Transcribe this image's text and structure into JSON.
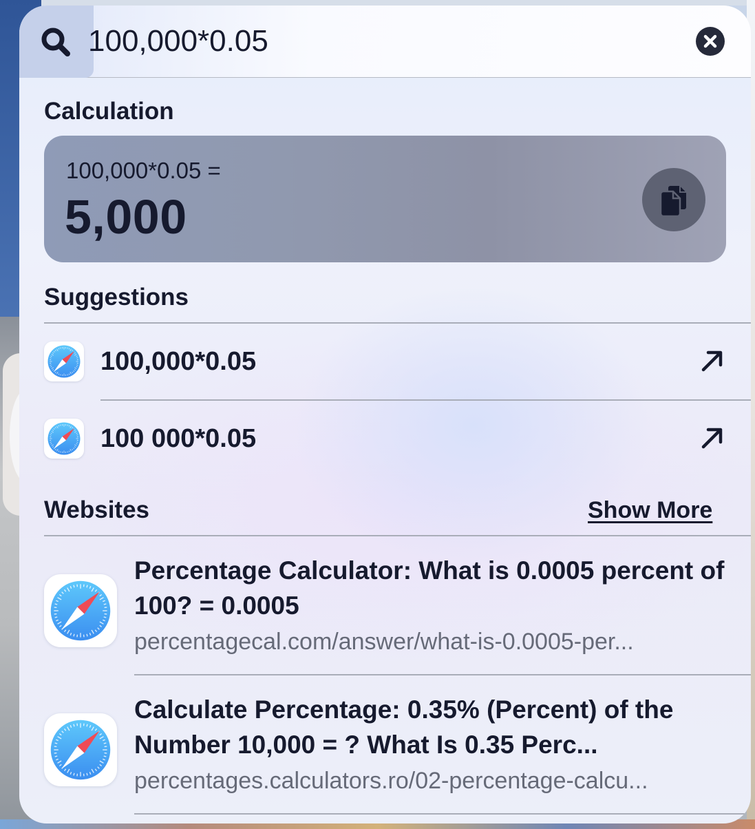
{
  "search": {
    "query": "100,000*0.05",
    "icon": "magnifying-glass",
    "clear_icon": "xmark-circle-fill"
  },
  "calculation": {
    "section_title": "Calculation",
    "expression": "100,000*0.05 =",
    "result": "5,000",
    "copy_icon": "doc-on-doc-fill"
  },
  "suggestions": {
    "section_title": "Suggestions",
    "items": [
      {
        "text": "100,000*0.05",
        "app_icon": "safari",
        "action_icon": "arrow-up-right"
      },
      {
        "text": "100 000*0.05",
        "app_icon": "safari",
        "action_icon": "arrow-up-right"
      }
    ]
  },
  "websites": {
    "section_title": "Websites",
    "show_more_label": "Show More",
    "items": [
      {
        "title": "Percentage Calculator: What is 0.0005 percent of 100? = 0.0005",
        "url": "percentagecal.com/answer/what-is-0.0005-per...",
        "app_icon": "safari"
      },
      {
        "title": "Calculate Percentage: 0.35% (Percent) of the Number 10,000 = ? What Is 0.35 Perc...",
        "url": "percentages.calculators.ro/02-percentage-calcu...",
        "app_icon": "safari"
      }
    ]
  },
  "colors": {
    "text_primary": "#161a2e",
    "text_secondary": "#666a78",
    "calc_card": "#9099af",
    "copy_button": "#5e6273",
    "safari_blue": "#3b8ef0",
    "safari_needle_red": "#ef4b55"
  }
}
